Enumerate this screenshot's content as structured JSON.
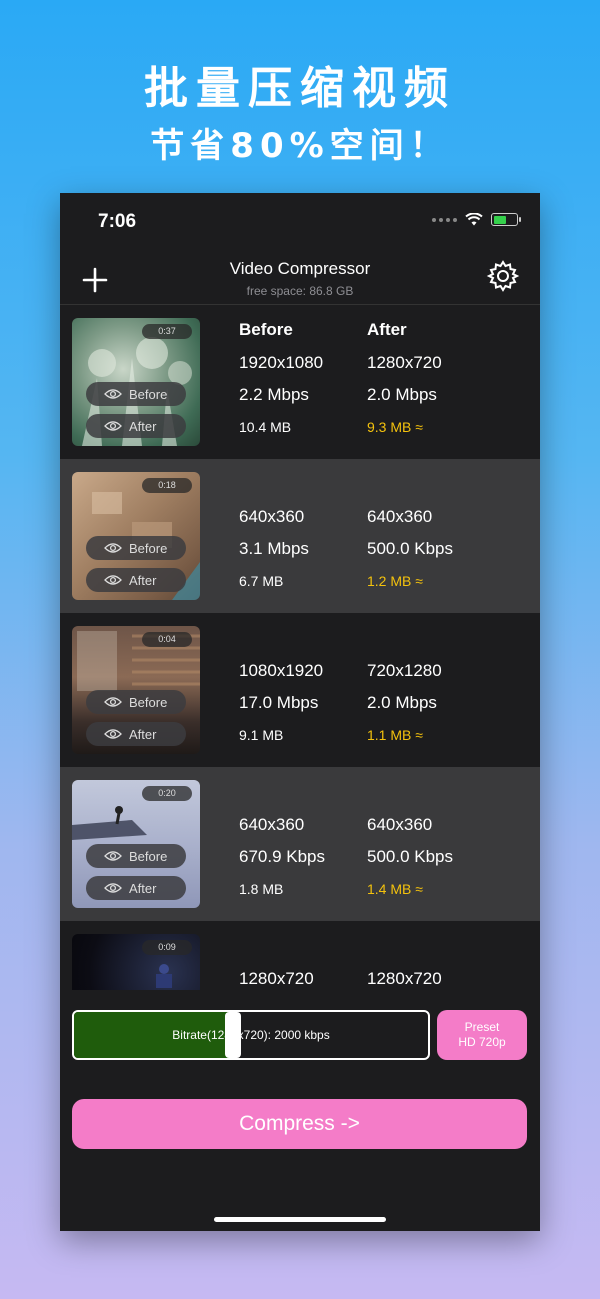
{
  "promo": {
    "title": "批量压缩视频",
    "subtitle": "节省80%空间！"
  },
  "status_bar": {
    "time": "7:06",
    "icons": [
      "signal-icon",
      "wifi-icon",
      "battery-charging-icon"
    ]
  },
  "nav": {
    "title": "Video Compressor",
    "subtitle": "free space: 86.8 GB",
    "add_icon": "plus-icon",
    "settings_icon": "gear-icon"
  },
  "columns": {
    "before": "Before",
    "after": "After"
  },
  "videos": [
    {
      "duration": "0:37",
      "before_res": "1920x1080",
      "after_res": "1280x720",
      "before_rate": "2.2 Mbps",
      "after_rate": "2.0 Mbps",
      "before_size": "10.4 MB",
      "after_size": "9.3 MB ≈",
      "before_btn": "Before",
      "after_btn": "After"
    },
    {
      "duration": "0:18",
      "before_res": "640x360",
      "after_res": "640x360",
      "before_rate": "3.1 Mbps",
      "after_rate": "500.0 Kbps",
      "before_size": "6.7 MB",
      "after_size": "1.2 MB ≈",
      "before_btn": "Before",
      "after_btn": "After"
    },
    {
      "duration": "0:04",
      "before_res": "1080x1920",
      "after_res": "720x1280",
      "before_rate": "17.0 Mbps",
      "after_rate": "2.0 Mbps",
      "before_size": "9.1 MB",
      "after_size": "1.1 MB ≈",
      "before_btn": "Before",
      "after_btn": "After"
    },
    {
      "duration": "0:20",
      "before_res": "640x360",
      "after_res": "640x360",
      "before_rate": "670.9 Kbps",
      "after_rate": "500.0 Kbps",
      "before_size": "1.8 MB",
      "after_size": "1.4 MB ≈",
      "before_btn": "Before",
      "after_btn": "After"
    },
    {
      "duration": "0:09",
      "before_res": "1280x720",
      "after_res": "1280x720"
    }
  ],
  "bitrate_slider": {
    "label": "Bitrate(1280x720): 2000 kbps",
    "level": 0.45
  },
  "preset": {
    "line1": "Preset",
    "line2": "HD 720p"
  },
  "compress_label": "Compress ->",
  "colors": {
    "accent_pink": "#f47cc8",
    "slider_green": "#1f5c0c",
    "estimate_yellow": "#f4c20d"
  }
}
